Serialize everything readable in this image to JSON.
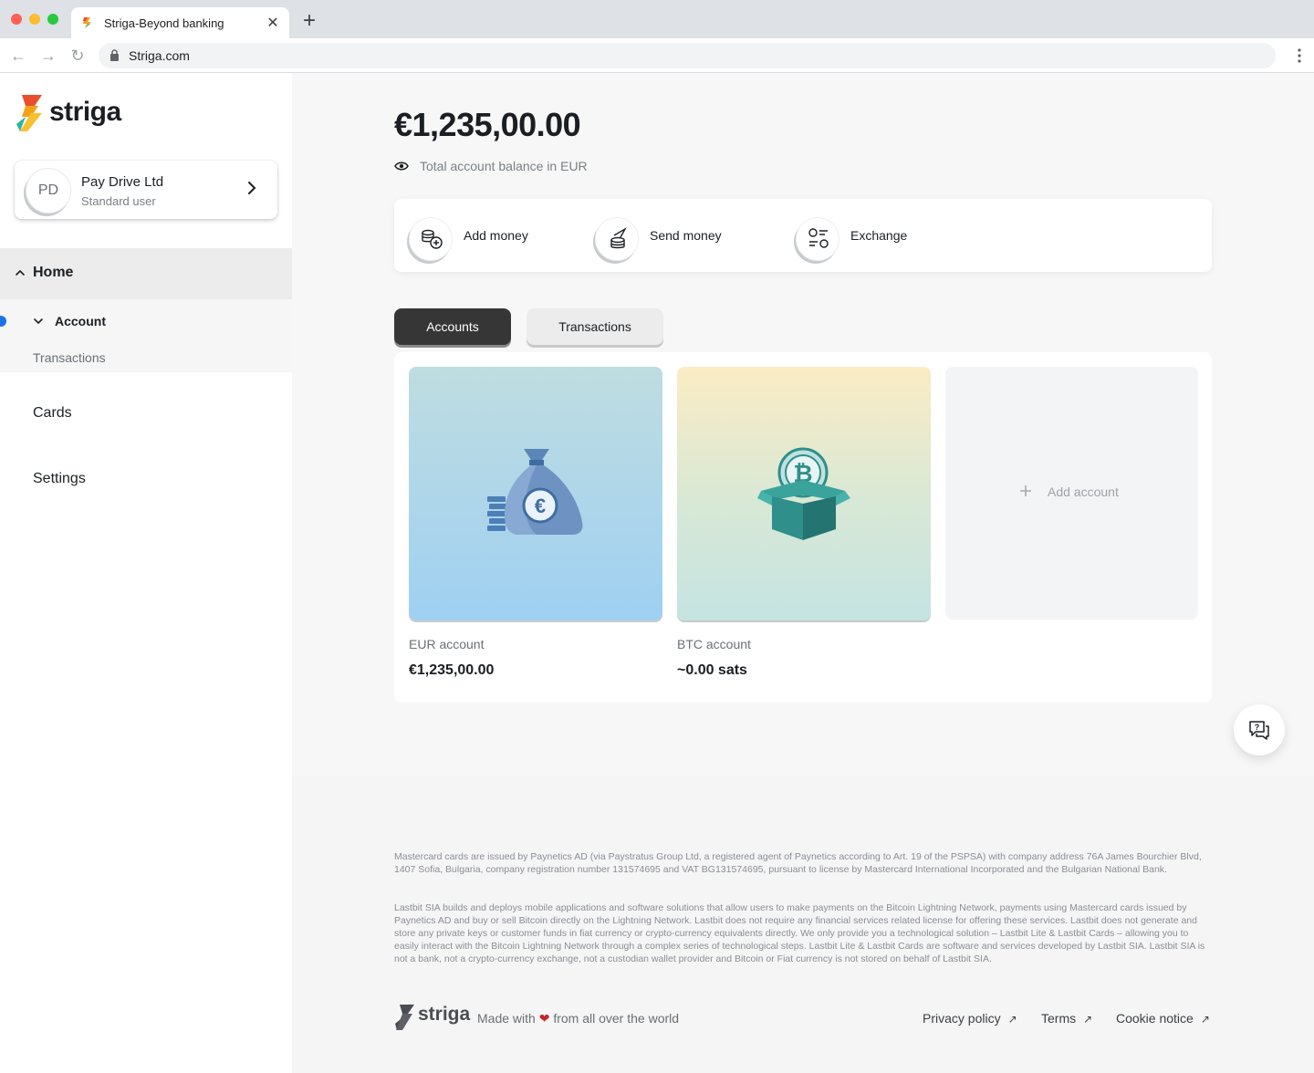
{
  "browser": {
    "tab_title": "Striga-Beyond banking",
    "url": "Striga.com"
  },
  "sidebar": {
    "logo_text": "striga",
    "user": {
      "initials": "PD",
      "name": "Pay Drive Ltd",
      "role": "Standard user"
    },
    "nav": {
      "home": "Home",
      "account": "Account",
      "transactions": "Transactions",
      "cards": "Cards",
      "settings": "Settings"
    }
  },
  "main": {
    "balance": "€1,235,00.00",
    "balance_caption": "Total account balance in EUR",
    "actions": [
      {
        "label": "Add money",
        "icon": "add-money-icon"
      },
      {
        "label": "Send money",
        "icon": "send-money-icon"
      },
      {
        "label": "Exchange",
        "icon": "exchange-icon"
      }
    ],
    "tabs": {
      "accounts": "Accounts",
      "transactions": "Transactions"
    },
    "accounts": [
      {
        "name": "EUR account",
        "value": "€1,235,00.00",
        "icon": "euro-money-bag-icon"
      },
      {
        "name": "BTC account",
        "value": "~0.00 sats",
        "icon": "bitcoin-box-icon"
      }
    ],
    "add_account": "Add account"
  },
  "footer": {
    "legal1": "Mastercard cards are issued by Paynetics AD (via Paystratus Group Ltd, a registered agent of Paynetics according to Art. 19 of the PSPSA) with company address 76A James Bourchier Blvd, 1407 Sofia, Bulgaria, company registration number 131574695 and VAT BG131574695, pursuant to license by Mastercard International Incorporated and the Bulgarian National Bank.",
    "legal2": "Lastbit SIA builds and deploys mobile applications and software solutions that allow users to make payments on the Bitcoin Lightning Network, payments using Mastercard cards issued by Paynetics AD and buy or sell Bitcoin directly on the Lightning Network. Lastbit does not require any financial services related license for offering these services. Lastbit does not generate and store any private keys or customer funds in fiat currency or crypto-currency equivalents directly. We only provide you a technological solution – Lastbit Lite & Lastbit Cards – allowing you to easily interact with the Bitcoin Lightning Network through a complex series of technological steps. Lastbit Lite & Lastbit Cards are software and services developed by Lastbit SIA. Lastbit SIA is not a bank, not a crypto-currency exchange, not a custodian wallet provider and Bitcoin or Fiat currency is not stored on behalf of Lastbit SIA.",
    "logo_text": "striga",
    "made_with_pre": "Made with",
    "made_with_post": "from all over the world",
    "links": {
      "privacy": "Privacy policy",
      "terms": "Terms",
      "cookie": "Cookie notice"
    }
  },
  "colors": {
    "accent_dark": "#363636",
    "active_indicator": "#1a73e8",
    "heart": "#c0272d"
  }
}
